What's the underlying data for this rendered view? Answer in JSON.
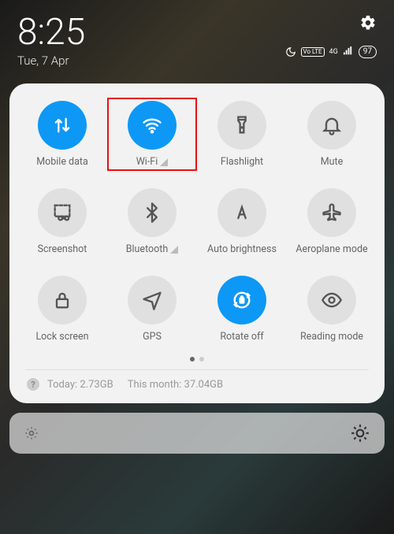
{
  "header": {
    "time": "8:25",
    "date": "Tue, 7 Apr",
    "battery": "97"
  },
  "tiles": [
    {
      "label": "Mobile data"
    },
    {
      "label": "Wi-Fi"
    },
    {
      "label": "Flashlight"
    },
    {
      "label": "Mute"
    },
    {
      "label": "Screenshot"
    },
    {
      "label": "Bluetooth"
    },
    {
      "label": "Auto brightness"
    },
    {
      "label": "Aeroplane mode"
    },
    {
      "label": "Lock screen"
    },
    {
      "label": "GPS"
    },
    {
      "label": "Rotate off"
    },
    {
      "label": "Reading mode"
    }
  ],
  "usage": {
    "today_label": "Today:",
    "today_value": "2.73GB",
    "month_label": "This month:",
    "month_value": "37.04GB"
  },
  "status": {
    "lte_badge": "Vo LTE",
    "net_badge": "4G"
  }
}
